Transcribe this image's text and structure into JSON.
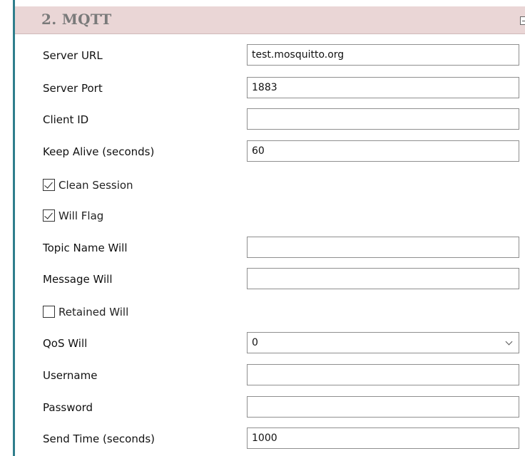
{
  "section": {
    "title": "2. MQTT"
  },
  "fields": {
    "server_url": {
      "label": "Server URL",
      "value": "test.mosquitto.org"
    },
    "server_port": {
      "label": "Server Port",
      "value": "1883"
    },
    "client_id": {
      "label": "Client ID",
      "value": ""
    },
    "keep_alive": {
      "label": "Keep Alive (seconds)",
      "value": "60"
    },
    "topic_name_will": {
      "label": "Topic Name Will",
      "value": ""
    },
    "message_will": {
      "label": "Message Will",
      "value": ""
    },
    "qos_will": {
      "label": "QoS Will",
      "value": "0"
    },
    "username": {
      "label": "Username",
      "value": ""
    },
    "password": {
      "label": "Password",
      "value": ""
    },
    "send_time": {
      "label": "Send Time (seconds)",
      "value": "1000"
    }
  },
  "checkboxes": {
    "clean_session": {
      "label": "Clean Session",
      "checked": true
    },
    "will_flag": {
      "label": "Will Flag",
      "checked": true
    },
    "retained_will": {
      "label": "Retained Will",
      "checked": false
    }
  },
  "icons": {
    "collapse": "collapse-minus-icon",
    "dropdown": "chevron-down-icon"
  },
  "colors": {
    "header_bg": "#ead6d6",
    "accent": "#2f7e8c",
    "title": "#7a7a7a"
  }
}
